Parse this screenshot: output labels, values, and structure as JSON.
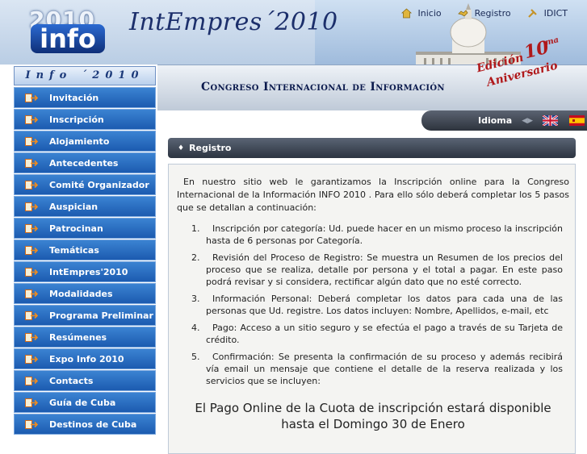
{
  "header": {
    "logo_year": "2010",
    "logo_word": "info",
    "site_title": "IntEmpres´2010",
    "nav": [
      {
        "label": "Inicio",
        "icon": "home-icon"
      },
      {
        "label": "Registro",
        "icon": "handshake-icon"
      },
      {
        "label": "IDICT",
        "icon": "tools-icon"
      }
    ]
  },
  "banner": {
    "title": "Congreso Internacional de Información",
    "badge_edicion": "Edición",
    "badge_num": "10",
    "badge_sup": "ma",
    "badge_aniversario": "Aniversario"
  },
  "sidebar": {
    "title": "Info ´2010",
    "items": [
      {
        "label": "Invitación"
      },
      {
        "label": "Inscripción"
      },
      {
        "label": "Alojamiento"
      },
      {
        "label": "Antecedentes"
      },
      {
        "label": "Comité Organizador"
      },
      {
        "label": "Auspician"
      },
      {
        "label": "Patrocinan"
      },
      {
        "label": "Temáticas"
      },
      {
        "label": "IntEmpres'2010"
      },
      {
        "label": "Modalidades"
      },
      {
        "label": "Programa Preliminar"
      },
      {
        "label": "Resúmenes"
      },
      {
        "label": "Expo Info 2010"
      },
      {
        "label": "Contacts"
      },
      {
        "label": "Guía de Cuba"
      },
      {
        "label": "Destinos de Cuba"
      }
    ]
  },
  "language": {
    "label": "Idioma",
    "options": [
      "English",
      "Español"
    ]
  },
  "section": {
    "title": "Registro"
  },
  "content": {
    "intro": "En nuestro sitio web le garantizamos la Inscripción online para la Congreso Internacional de la Información INFO 2010 . Para ello sólo deberá completar los 5 pasos que se detallan a continuación:",
    "steps": [
      {
        "num": "1.",
        "text": "Inscripción por categoría: Ud. puede hacer en un mismo proceso la inscripción hasta de 6 personas por Categoría."
      },
      {
        "num": "2.",
        "text": "Revisión del Proceso de Registro: Se muestra un Resumen de los precios del proceso que se realiza, detalle por persona y el total a pagar. En este paso podrá revisar y si considera, rectificar algún dato que no esté correcto."
      },
      {
        "num": "3.",
        "text": "Información Personal: Deberá completar los datos para cada una de las personas que Ud. registre. Los datos incluyen: Nombre, Apellidos, e-mail, etc"
      },
      {
        "num": "4.",
        "text": "Pago: Acceso a un sitio seguro y se efectúa el pago a través de su Tarjeta de crédito."
      },
      {
        "num": "5.",
        "text": "Confirmación: Se presenta la confirmación de su proceso y además recibirá vía email un mensaje que contiene el detalle de la reserva realizada y los servicios que se incluyen:"
      }
    ],
    "notice": "El Pago Online de la Cuota de inscripción estará disponible hasta el Domingo 30 de Enero"
  },
  "colors": {
    "menu_blue": "#1c5bb0",
    "section_bar": "#2c3441",
    "banner_text": "#0b1a4d",
    "badge_red": "#b0181a"
  }
}
